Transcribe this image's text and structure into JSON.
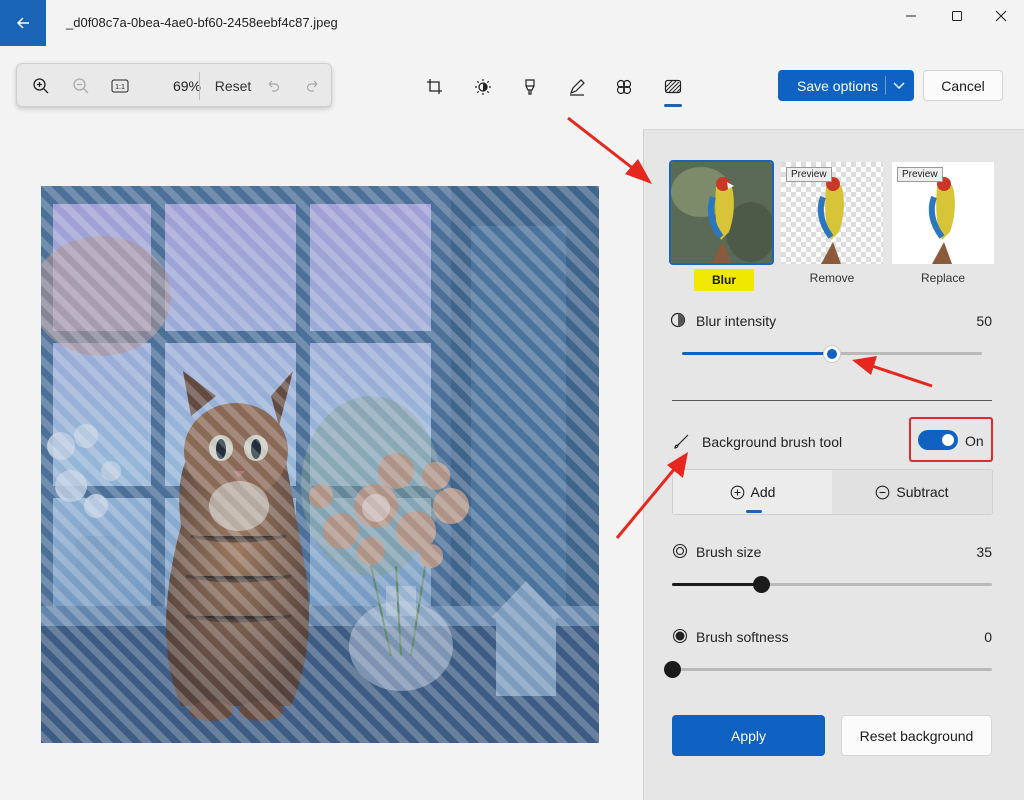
{
  "title_bar": {
    "file_name": "_d0f08c7a-0bea-4ae0-bf60-2458eebf4c87.jpeg"
  },
  "zoom_bar": {
    "zoom_level": "69%",
    "reset_label": "Reset",
    "actual_size_label": "1:1"
  },
  "toolbar": {
    "tools": [
      "crop-icon",
      "adjust-icon",
      "markup-icon",
      "draw-icon",
      "erase-icon",
      "background-icon"
    ],
    "save_label": "Save options",
    "cancel_label": "Cancel"
  },
  "panel": {
    "options": [
      {
        "label": "Blur",
        "badge": ""
      },
      {
        "label": "Remove",
        "badge": "Preview"
      },
      {
        "label": "Replace",
        "badge": "Preview"
      }
    ],
    "blur_intensity": {
      "label": "Blur intensity",
      "value": "50",
      "fraction": 0.5
    },
    "brush_tool": {
      "label": "Background brush tool",
      "toggle_label": "On"
    },
    "segment": {
      "add_label": "Add",
      "subtract_label": "Subtract"
    },
    "brush_size": {
      "label": "Brush size",
      "value": "35",
      "fraction": 0.28
    },
    "brush_softness": {
      "label": "Brush softness",
      "value": "0",
      "fraction": 0
    },
    "apply_label": "Apply",
    "reset_background_label": "Reset background"
  },
  "colors": {
    "accent": "#0f62c1",
    "highlight": "#f0e800",
    "annotation_red": "#e02b2b"
  }
}
